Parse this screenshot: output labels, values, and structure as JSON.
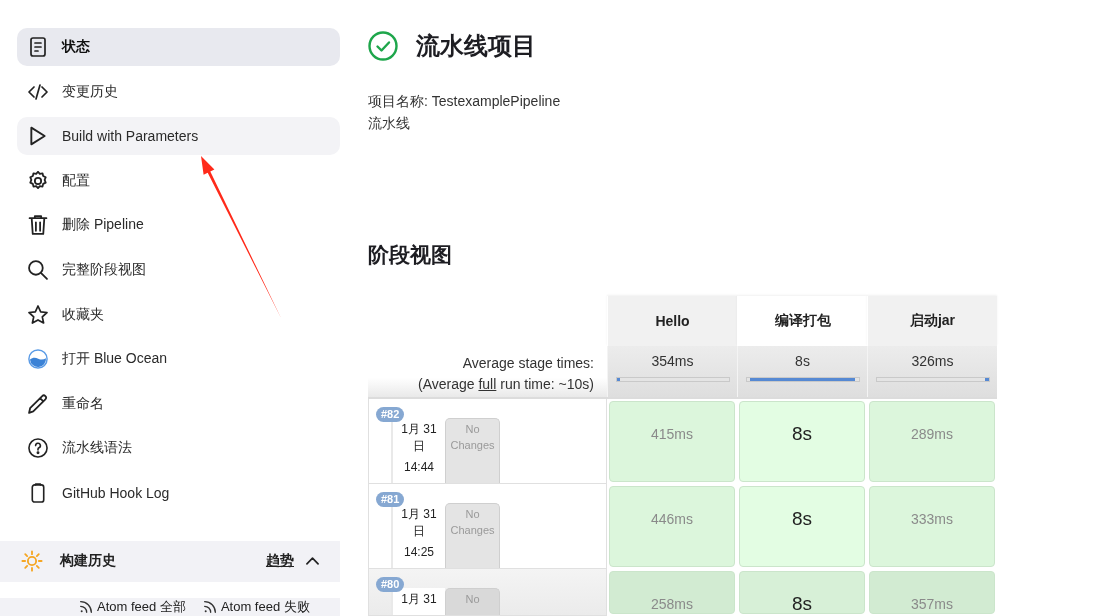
{
  "sidebar": {
    "items": [
      {
        "label": "状态",
        "selected": true,
        "hovered": false
      },
      {
        "label": "变更历史",
        "selected": false,
        "hovered": false
      },
      {
        "label": "Build with Parameters",
        "selected": false,
        "hovered": true
      },
      {
        "label": "配置",
        "selected": false,
        "hovered": false
      },
      {
        "label": "删除 Pipeline",
        "selected": false,
        "hovered": false
      },
      {
        "label": "完整阶段视图",
        "selected": false,
        "hovered": false
      },
      {
        "label": "收藏夹",
        "selected": false,
        "hovered": false
      },
      {
        "label": "打开 Blue Ocean",
        "selected": false,
        "hovered": false
      },
      {
        "label": "重命名",
        "selected": false,
        "hovered": false
      },
      {
        "label": "流水线语法",
        "selected": false,
        "hovered": false
      },
      {
        "label": "GitHub Hook Log",
        "selected": false,
        "hovered": false
      }
    ]
  },
  "build_history": {
    "title": "构建历史",
    "trend": "趋势",
    "expanded": true
  },
  "feeds": [
    {
      "label": "Atom feed 全部"
    },
    {
      "label": "Atom feed 失败"
    }
  ],
  "header": {
    "succeeded": true,
    "title": "流水线项目"
  },
  "description": [
    "项目名称: TestexamplePipeline",
    "流水线"
  ],
  "stage_view": {
    "title": "阶段视图",
    "average_label": "Average stage times:",
    "run_time": {
      "before": "(Average ",
      "link": "full",
      "after": " run time: ~10s)"
    },
    "stages": [
      {
        "name": "Hello",
        "highlighted": false,
        "average": "354ms",
        "level": 0.03,
        "kind": "start"
      },
      {
        "name": "编译打包",
        "highlighted": true,
        "average": "8s",
        "level": 0.94,
        "kind": "middle"
      },
      {
        "name": "启动jar",
        "highlighted": false,
        "average": "326ms",
        "level": 0.03,
        "kind": "end"
      }
    ],
    "builds": [
      {
        "number": "#82",
        "date": "1月 31 日",
        "time": "14:44",
        "changes": "No Changes",
        "highlighted": false,
        "durations": [
          "415ms",
          "8s",
          "289ms"
        ]
      },
      {
        "number": "#81",
        "date": "1月 31 日",
        "time": "14:25",
        "changes": "No Changes",
        "highlighted": false,
        "durations": [
          "446ms",
          "8s",
          "333ms"
        ]
      },
      {
        "number": "#80",
        "date": "1月 31",
        "changes": "No",
        "highlighted": true,
        "durations": [
          "258ms",
          "8s",
          "357ms"
        ]
      }
    ]
  },
  "annotation": {
    "kind": "arrow"
  }
}
